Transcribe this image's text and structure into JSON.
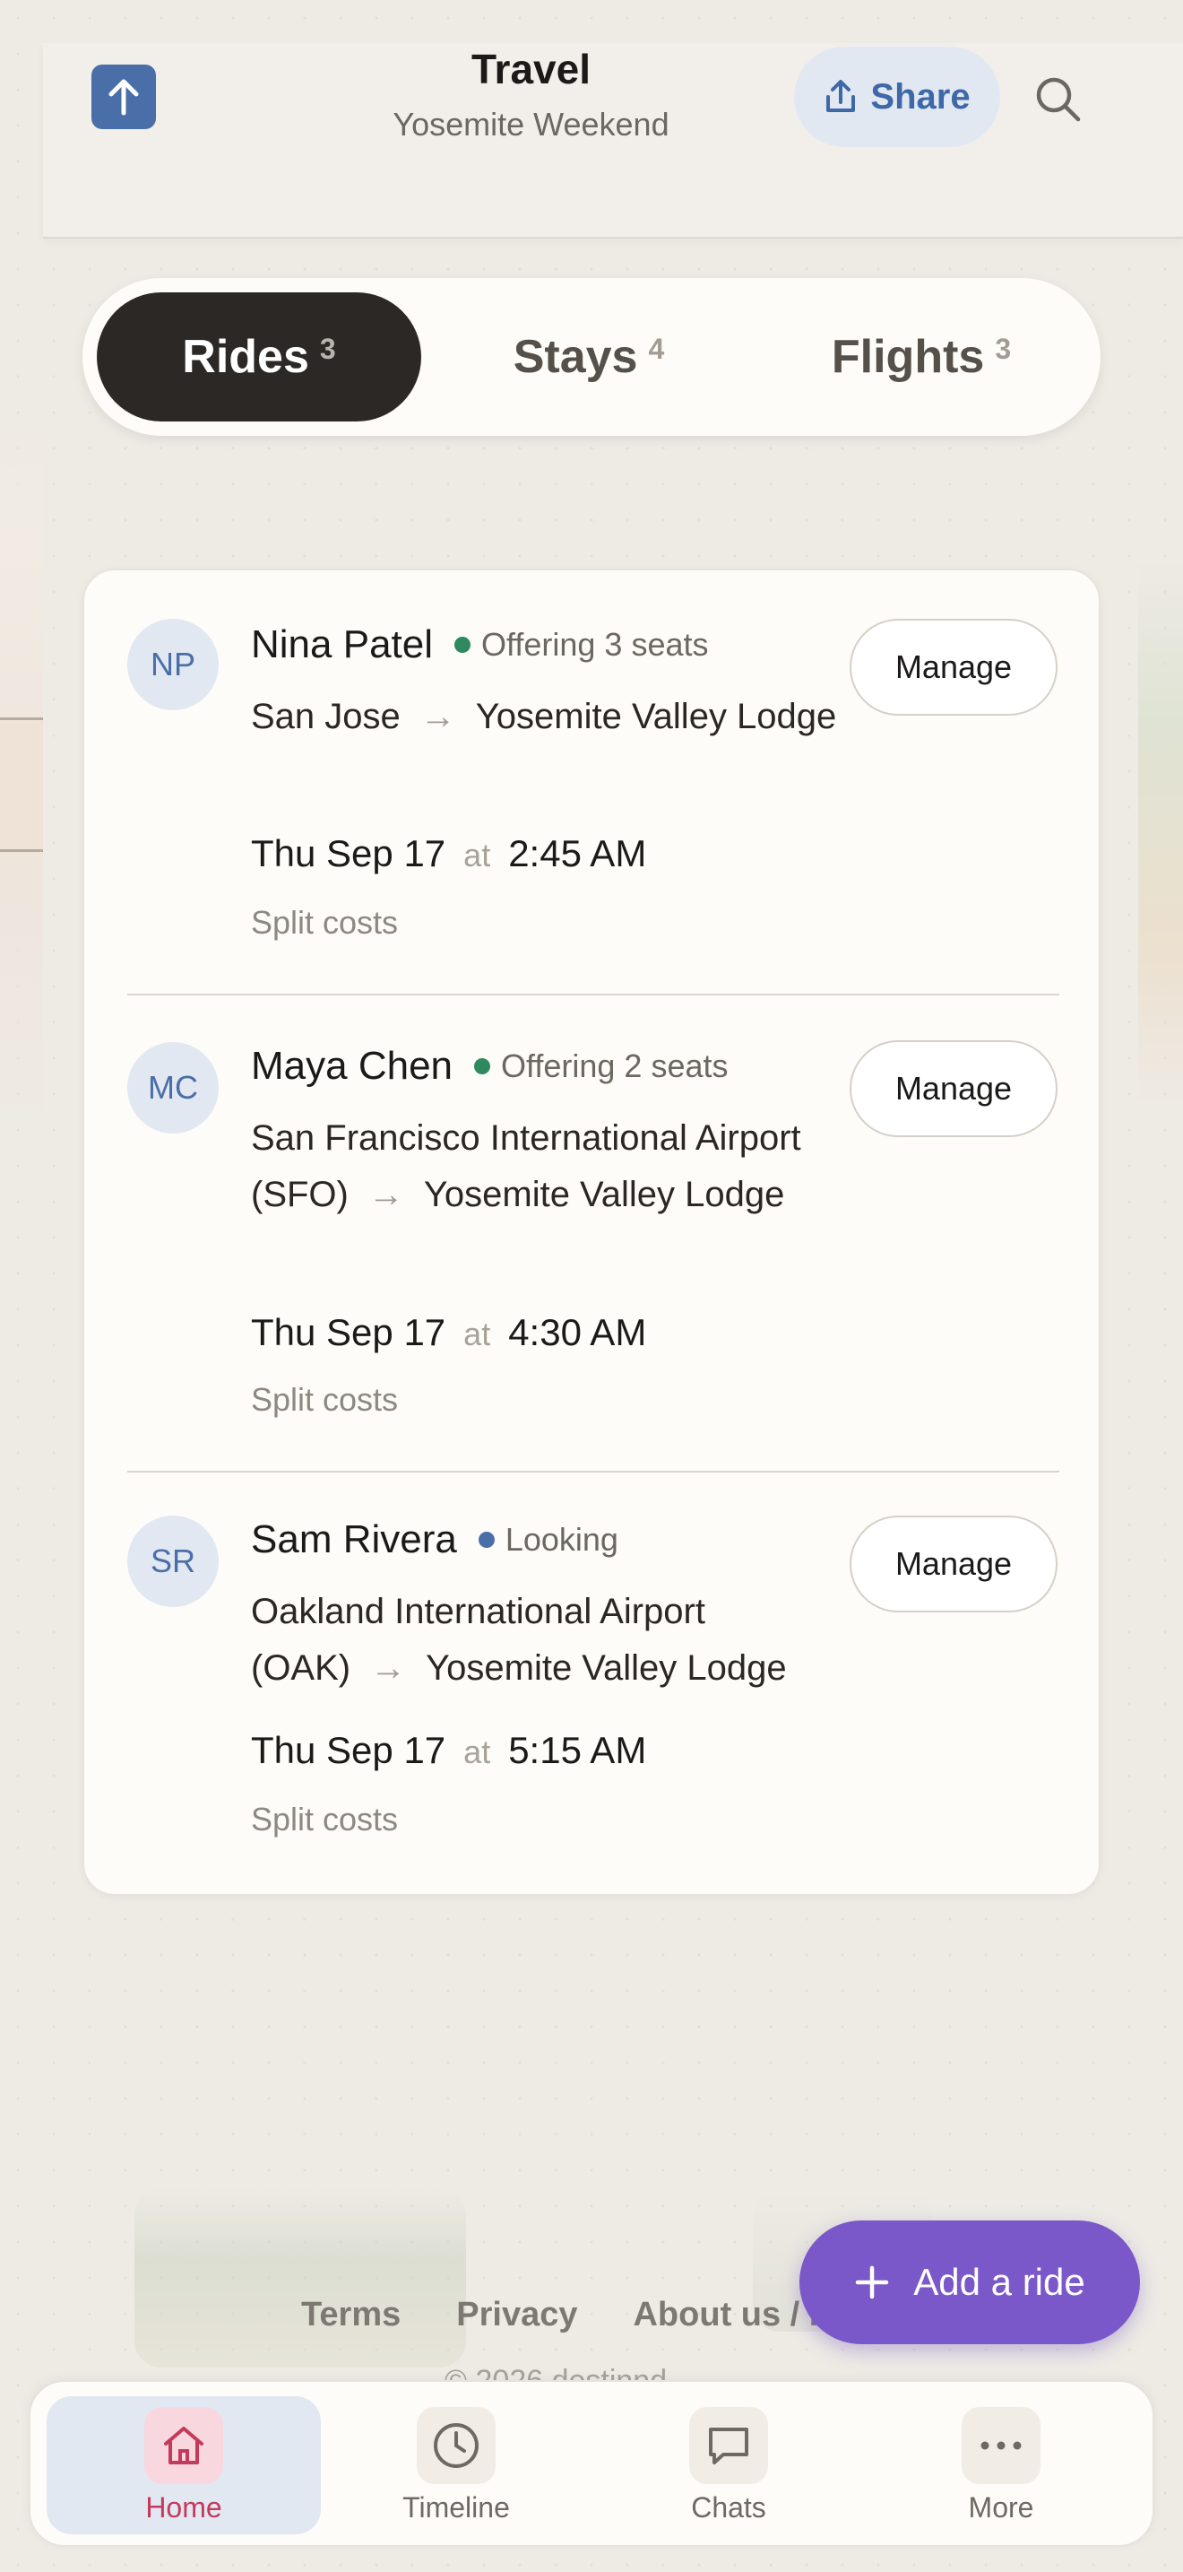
{
  "header": {
    "title": "Travel",
    "subtitle": "Yosemite Weekend",
    "share_label": "Share"
  },
  "tabs": [
    {
      "label": "Rides",
      "count": "3",
      "active": true
    },
    {
      "label": "Stays",
      "count": "4",
      "active": false
    },
    {
      "label": "Flights",
      "count": "3",
      "active": false
    }
  ],
  "rides": [
    {
      "initials": "NP",
      "name": "Nina Patel",
      "status": "Offering 3 seats",
      "status_color": "#2e8a5e",
      "from": "San Jose",
      "to": "Yosemite Valley Lodge",
      "date": "Thu Sep 17",
      "at": "at",
      "time": "2:45 AM",
      "costs": "Split costs",
      "action": "Manage"
    },
    {
      "initials": "MC",
      "name": "Maya Chen",
      "status": "Offering 2 seats",
      "status_color": "#2e8a5e",
      "from": "San Francisco International Airport (SFO)",
      "to": "Yosemite Valley Lodge",
      "date": "Thu Sep 17",
      "at": "at",
      "time": "4:30 AM",
      "costs": "Split costs",
      "action": "Manage"
    },
    {
      "initials": "SR",
      "name": "Sam Rivera",
      "status": "Looking",
      "status_color": "#4a6fa8",
      "from": "Oakland International Airport (OAK)",
      "to": "Yosemite Valley Lodge",
      "date": "Thu Sep 17",
      "at": "at",
      "time": "5:15 AM",
      "costs": "Split costs",
      "action": "Manage"
    }
  ],
  "footer": {
    "links": [
      "Terms",
      "Privacy",
      "About us / F"
    ],
    "copyright": "© 2026 destinnd"
  },
  "fab": {
    "label": "Add a ride"
  },
  "nav": [
    {
      "label": "Home",
      "icon": "home-icon",
      "active": true
    },
    {
      "label": "Timeline",
      "icon": "clock-icon",
      "active": false
    },
    {
      "label": "Chats",
      "icon": "chat-icon",
      "active": false
    },
    {
      "label": "More",
      "icon": "more-icon",
      "active": false
    }
  ],
  "colors": {
    "accent": "#4a6fa8",
    "fab": "#7a58c9",
    "active_tab": "#2b2825",
    "nav_active": "#c43a5a"
  }
}
